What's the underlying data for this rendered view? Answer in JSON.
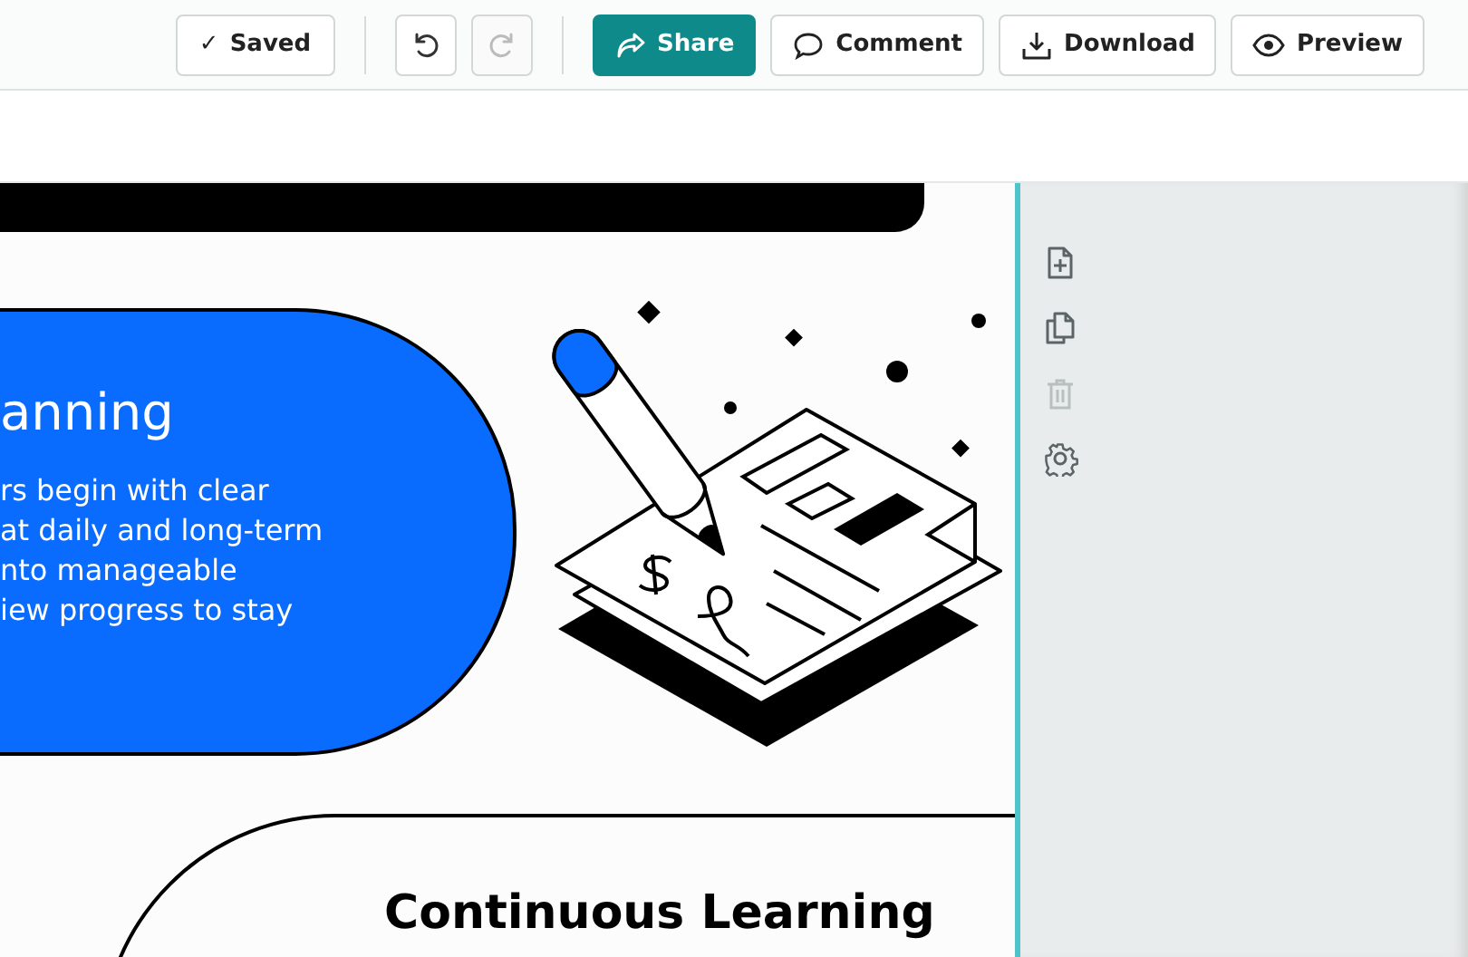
{
  "toolbar": {
    "status": {
      "icon": "✓",
      "label": "Saved"
    },
    "history": [
      {
        "kind": "undo",
        "disabled": false
      },
      {
        "kind": "redo",
        "disabled": true
      }
    ],
    "actions": [
      {
        "kind": "share",
        "label": "Share",
        "primary": true
      },
      {
        "kind": "comment",
        "label": "Comment",
        "primary": false
      },
      {
        "kind": "download",
        "label": "Download",
        "primary": false
      },
      {
        "kind": "preview",
        "label": "Preview",
        "primary": false
      }
    ]
  },
  "slide": {
    "pill": {
      "title": "anning",
      "lines": [
        "rs begin with clear",
        "at daily and long-term",
        "nto manageable",
        "iew progress to stay"
      ]
    },
    "section_heading": "Continuous Learning"
  },
  "side_tools": [
    {
      "kind": "add-page",
      "disabled": false
    },
    {
      "kind": "duplicate",
      "disabled": false
    },
    {
      "kind": "delete",
      "disabled": true
    },
    {
      "kind": "settings",
      "disabled": false
    }
  ]
}
